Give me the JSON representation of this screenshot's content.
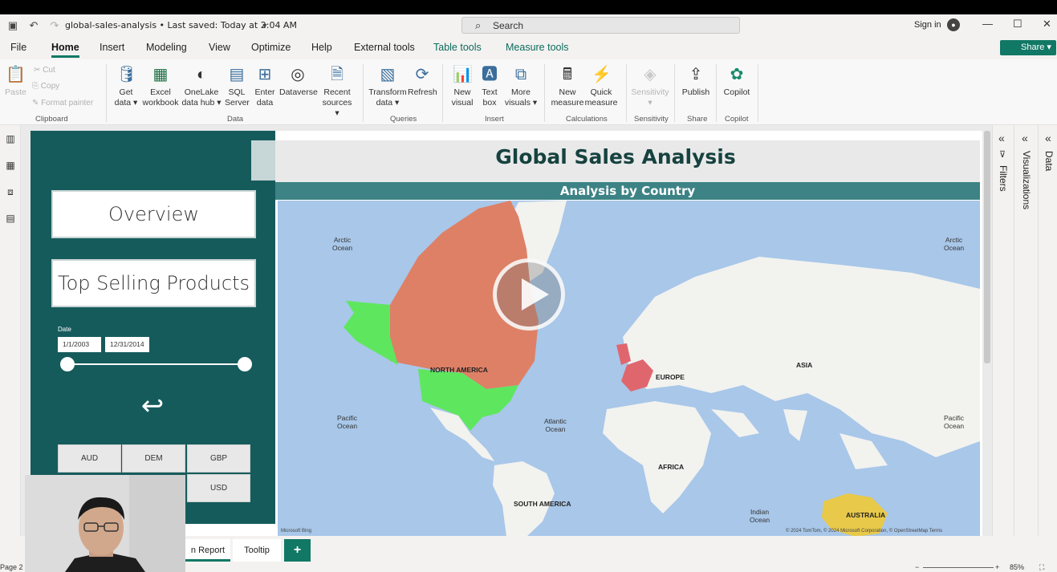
{
  "titlebar": {
    "doc_title": "global-sales-analysis • Last saved: Today at 2:04 AM",
    "search_placeholder": "Search",
    "signin": "Sign in"
  },
  "menu": {
    "tabs": [
      "File",
      "Home",
      "Insert",
      "Modeling",
      "View",
      "Optimize",
      "Help",
      "External tools",
      "Table tools",
      "Measure tools"
    ],
    "active": "Home",
    "share": "Share"
  },
  "ribbon": {
    "clipboard": {
      "paste": "Paste",
      "cut": "Cut",
      "copy": "Copy",
      "format_painter": "Format painter",
      "group": "Clipboard"
    },
    "data": {
      "get_data": [
        "Get",
        "data"
      ],
      "excel": [
        "Excel",
        "workbook"
      ],
      "onelake": [
        "OneLake",
        "data hub"
      ],
      "sql": [
        "SQL",
        "Server"
      ],
      "enter": [
        "Enter",
        "data"
      ],
      "dataverse": "Dataverse",
      "recent": [
        "Recent",
        "sources"
      ],
      "group": "Data"
    },
    "queries": {
      "transform": [
        "Transform",
        "data"
      ],
      "refresh": "Refresh",
      "group": "Queries"
    },
    "insert": {
      "new_visual": [
        "New",
        "visual"
      ],
      "text_box": [
        "Text",
        "box"
      ],
      "more_visuals": [
        "More",
        "visuals"
      ],
      "group": "Insert"
    },
    "calculations": {
      "new_measure": [
        "New",
        "measure"
      ],
      "quick_measure": [
        "Quick",
        "measure"
      ],
      "group": "Calculations"
    },
    "sensitivity": {
      "label": "Sensitivity",
      "group": "Sensitivity"
    },
    "share": {
      "publish": "Publish",
      "group": "Share"
    },
    "copilot": {
      "label": "Copilot",
      "group": "Copilot"
    }
  },
  "report": {
    "title": "Global Sales Analysis",
    "subtitle": "Analysis by Country",
    "nav_buttons": [
      "Overview",
      "Top Selling Products"
    ],
    "date_label": "Date",
    "date_start": "1/1/2003",
    "date_end": "12/31/2014",
    "currencies": [
      "AUD",
      "DEM",
      "GBP",
      "USD"
    ]
  },
  "map": {
    "labels": {
      "arctic_left": [
        "Arctic",
        "Ocean"
      ],
      "arctic_right": [
        "Arctic",
        "Ocean"
      ],
      "pacific_left": [
        "Pacific",
        "Ocean"
      ],
      "pacific_right": [
        "Pacific",
        "Ocean"
      ],
      "atlantic": [
        "Atlantic",
        "Ocean"
      ],
      "indian": [
        "Indian",
        "Ocean"
      ],
      "north_america": "NORTH AMERICA",
      "europe": "EUROPE",
      "asia": "ASIA",
      "africa": "AFRICA",
      "south_america": "SOUTH AMERICA",
      "australia": "AUSTRALIA"
    },
    "brand": "Microsoft Bing",
    "credit": "© 2024 TomTom, © 2024 Microsoft Corporation, © OpenStreetMap  Terms",
    "colors": {
      "ocean": "#a8c7e9",
      "land": "#f2f2ef",
      "orange": "#de8066",
      "green": "#5fe65f",
      "red": "#e0666e",
      "yellow": "#e8c94a"
    }
  },
  "panes": {
    "filters": "Filters",
    "visualizations": "Visualizations",
    "data": "Data"
  },
  "tabs": {
    "report": "n Report",
    "tooltip": "Tooltip",
    "add": "+"
  },
  "status": {
    "page": "Page 2 of 3",
    "zoom": "85%"
  }
}
